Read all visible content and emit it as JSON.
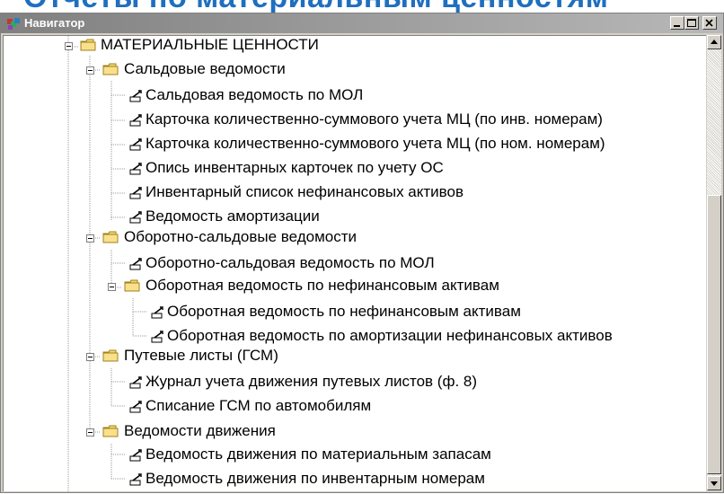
{
  "banner": {
    "text": "Отчеты по материальным ценностям"
  },
  "window": {
    "title": "Навигатор",
    "controls": [
      "minimize-icon",
      "maximize-icon",
      "close-icon"
    ]
  },
  "tree": {
    "root": {
      "label": "МАТЕРИАЛЬНЫЕ ЦЕННОСТИ",
      "icon": "folder-icon",
      "expanded": true
    },
    "groups": [
      {
        "label": "Сальдовые ведомости",
        "icon": "folder-icon",
        "items": [
          {
            "label": "Сальдовая ведомость по МОЛ",
            "icon": "report-icon"
          },
          {
            "label": "Карточка количественно-суммового учета МЦ (по инв. номерам)",
            "icon": "report-icon"
          },
          {
            "label": "Карточка количественно-суммового учета МЦ (по ном. номерам)",
            "icon": "report-icon"
          },
          {
            "label": "Опись инвентарных карточек по учету ОС",
            "icon": "report-icon"
          },
          {
            "label": "Инвентарный список нефинансовых активов",
            "icon": "report-icon"
          },
          {
            "label": "Ведомость амортизации",
            "icon": "report-icon"
          }
        ]
      },
      {
        "label": "Оборотно-сальдовые ведомости",
        "icon": "folder-icon",
        "items": [
          {
            "label": "Оборотно-сальдовая ведомость по МОЛ",
            "icon": "report-icon"
          }
        ],
        "subgroup": {
          "label": "Оборотная ведомость по нефинансовым активам",
          "icon": "folder-icon",
          "items": [
            {
              "label": "Оборотная ведомость по нефинансовым активам",
              "icon": "report-icon"
            },
            {
              "label": "Оборотная ведомость по амортизации нефинансовых активов",
              "icon": "report-icon"
            }
          ]
        }
      },
      {
        "label": "Путевые листы (ГСМ)",
        "icon": "folder-icon",
        "items": [
          {
            "label": "Журнал учета движения путевых листов (ф. 8)",
            "icon": "report-icon"
          },
          {
            "label": "Списание ГСМ по автомобилям",
            "icon": "report-icon"
          }
        ]
      },
      {
        "label": "Ведомости движения",
        "icon": "folder-icon",
        "items": [
          {
            "label": "Ведомость движения по материальным запасам",
            "icon": "report-icon"
          },
          {
            "label": "Ведомость движения по инвентарным номерам",
            "icon": "report-icon"
          }
        ]
      }
    ]
  },
  "scrollbar": {
    "up_icon": "arrow-up-icon",
    "down_icon": "arrow-down-icon"
  },
  "colors": {
    "banner": "#1f6fbf",
    "titlebar": "#808080",
    "folder": "#f5d76e"
  }
}
